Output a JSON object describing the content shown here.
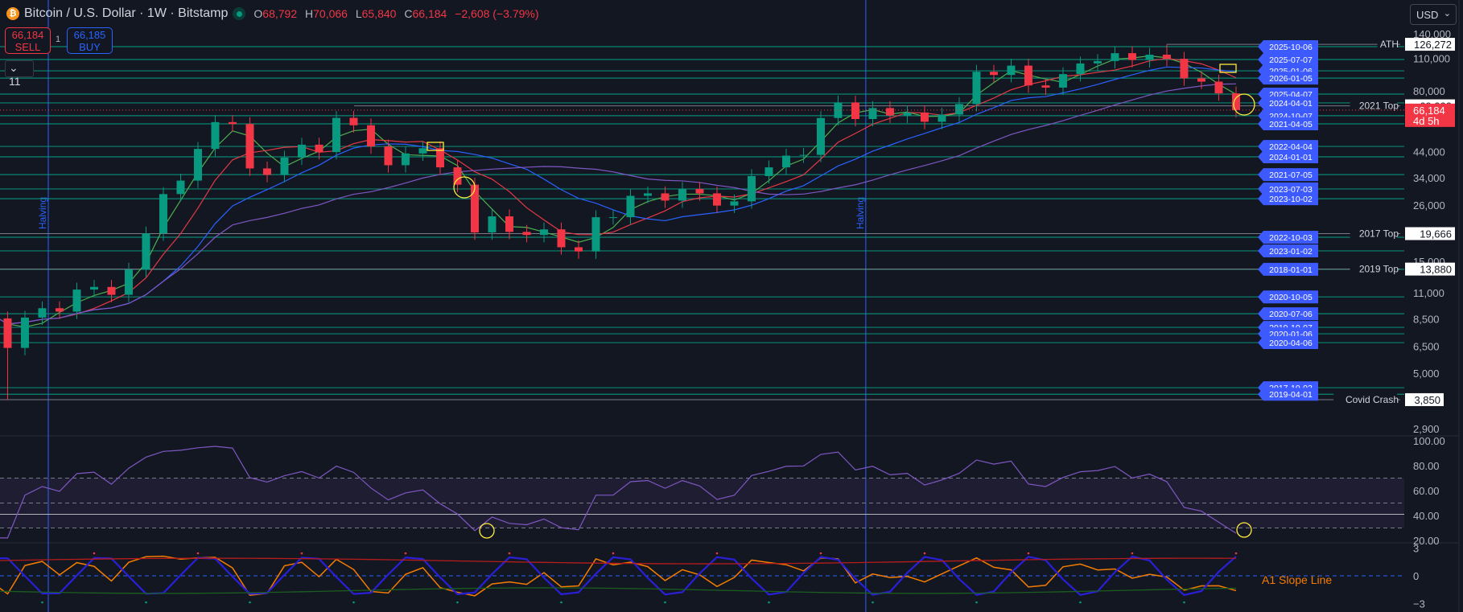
{
  "header": {
    "icon": "bitcoin-icon",
    "title": "Bitcoin / U.S. Dollar · 1W · Bitstamp",
    "o_label": "O",
    "o": "68,792",
    "h_label": "H",
    "h": "70,066",
    "l_label": "L",
    "l": "65,840",
    "c_label": "C",
    "c": "66,184",
    "change": "−2,608 (−3.79%)"
  },
  "trade": {
    "sell_price": "66,184",
    "sell_label": "SELL",
    "buy_price": "66,185",
    "buy_label": "BUY",
    "qty": "1"
  },
  "collapse": {
    "count": "11"
  },
  "currency": {
    "selected": "USD"
  },
  "colors": {
    "bg": "#131722",
    "up": "#089981",
    "down": "#f23645",
    "level": "#089981",
    "tag": "#3d5afe",
    "ma_fast": "#4caf50",
    "ma_mid": "#e53945",
    "ma_slow": "#2962ff",
    "ma_long": "#7e57c2",
    "rsi": "#7e57c2",
    "halving": "#2962ff"
  },
  "chart_data": {
    "type": "candlestick",
    "title": "Bitcoin / U.S. Dollar · 1W · Bitstamp",
    "scale": "log",
    "ylim": [
      2900,
      140000
    ],
    "start": "2020-01",
    "closes": [
      9350,
      8550,
      6400,
      8620,
      9450,
      9140,
      11350,
      11650,
      10780,
      13800,
      19700,
      29000,
      33100,
      45200,
      58800,
      57700,
      37300,
      35000,
      41500,
      47100,
      43800,
      61300,
      57000,
      46300,
      38500,
      43200,
      45500,
      37700,
      31800,
      19900,
      23300,
      20000,
      19400,
      20500,
      17200,
      16500,
      23100,
      23100,
      28500,
      29200,
      27200,
      30500,
      29200,
      25900,
      27000,
      34600,
      37700,
      42300,
      42600,
      61200,
      71300,
      60600,
      67500,
      62700,
      64600,
      59000,
      63300,
      70200,
      96400,
      93400,
      102400,
      84300,
      82500,
      94200,
      104600,
      107100,
      115700,
      108200,
      114000,
      109500,
      90400,
      87500,
      78000,
      66184
    ],
    "first_open": 7200,
    "price_ticks": [
      "140,000",
      "110,000",
      "80,000",
      "44,000",
      "34,000",
      "26,000",
      "15,000",
      "11,000",
      "8,500",
      "6,500",
      "5,000",
      "2,900"
    ],
    "price_tick_values": [
      140000,
      110000,
      80000,
      44000,
      34000,
      26000,
      15000,
      11000,
      8500,
      6500,
      5000,
      2900
    ],
    "current_price": "66,184",
    "countdown": "4d 5h",
    "halvings": [
      {
        "label": "Halving",
        "month_index": 4.35
      },
      {
        "label": "Halving",
        "month_index": 51.6
      }
    ],
    "key_levels": [
      {
        "label": "ATH",
        "value": 126272,
        "text": "126,272"
      },
      {
        "label": "2021 Top",
        "value": 69000,
        "text": "69,000"
      },
      {
        "label": "2017 Top",
        "value": 19666,
        "text": "19,666"
      },
      {
        "label": "2019 Top",
        "value": 13880,
        "text": "13,880"
      },
      {
        "label": "Covid Crash",
        "value": 3850,
        "text": "3,850"
      }
    ],
    "dated_levels": [
      {
        "date": "2025-10-06",
        "value": 123400
      },
      {
        "date": "2025-07-07",
        "value": 108700
      },
      {
        "date": "2025-01-06",
        "value": 97300
      },
      {
        "date": "2026-01-05",
        "value": 90600
      },
      {
        "date": "2025-04-07",
        "value": 77400
      },
      {
        "date": "2024-04-01",
        "value": 71000
      },
      {
        "date": "2024-10-07",
        "value": 62600
      },
      {
        "date": "2021-04-05",
        "value": 57800
      },
      {
        "date": "2022-04-04",
        "value": 46300
      },
      {
        "date": "2024-01-01",
        "value": 41800
      },
      {
        "date": "2021-07-05",
        "value": 35100
      },
      {
        "date": "2023-07-03",
        "value": 30500
      },
      {
        "date": "2023-10-02",
        "value": 27700
      },
      {
        "date": "2022-10-03",
        "value": 18980
      },
      {
        "date": "2023-01-02",
        "value": 16600
      },
      {
        "date": "2018-01-01",
        "value": 13850
      },
      {
        "date": "2020-10-05",
        "value": 10560
      },
      {
        "date": "2020-07-06",
        "value": 8950
      },
      {
        "date": "2019-10-07",
        "value": 7830
      },
      {
        "date": "2020-01-06",
        "value": 7350
      },
      {
        "date": "2020-04-06",
        "value": 6740
      },
      {
        "date": "2017-10-02",
        "value": 4330
      },
      {
        "date": "2019-04-01",
        "value": 4060
      }
    ],
    "rsi": {
      "ticks": [
        "100.00",
        "80.00",
        "60.00",
        "40.00",
        "20.00"
      ],
      "tick_values": [
        100,
        80,
        60,
        40,
        20
      ],
      "bands": [
        70,
        50,
        30
      ],
      "signal_line": 41
    },
    "oscillator": {
      "label": "A1 Slope Line",
      "ticks": [
        "3",
        "0",
        "−3"
      ],
      "tick_values": [
        3,
        0,
        -3
      ]
    }
  }
}
